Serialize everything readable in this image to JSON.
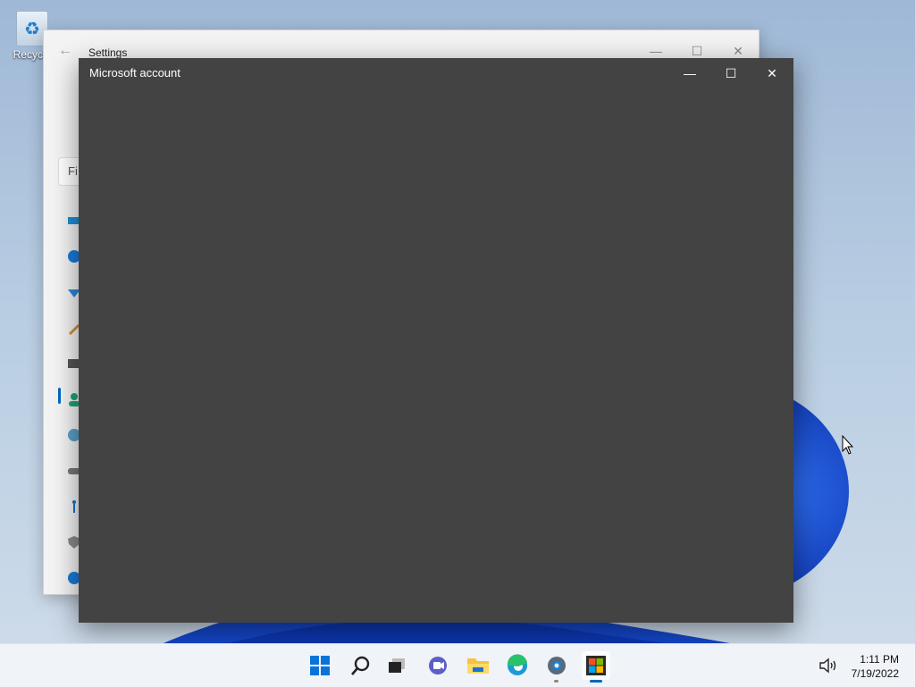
{
  "desktop": {
    "icons": [
      {
        "label": "Recycle",
        "icon": "recycle-bin-icon"
      }
    ]
  },
  "settings_window": {
    "title": "Settings",
    "search_placeholder": "Fi",
    "controls": {
      "minimize": "minimize-icon",
      "maximize": "maximize-icon",
      "close": "close-icon"
    },
    "nav_icons": [
      "system-icon",
      "bluetooth-icon",
      "network-icon",
      "personalization-icon",
      "apps-icon",
      "accounts-icon",
      "time-language-icon",
      "gaming-icon",
      "accessibility-icon",
      "privacy-security-icon",
      "windows-update-icon"
    ],
    "selected_nav": "accounts-icon"
  },
  "msa_dialog": {
    "title": "Microsoft account",
    "background": "#434343",
    "controls": {
      "minimize": "minimize-icon",
      "maximize": "maximize-icon",
      "close": "close-icon"
    }
  },
  "taskbar": {
    "apps": [
      "start-icon",
      "search-icon",
      "task-view-icon",
      "chat-icon",
      "file-explorer-icon",
      "edge-icon",
      "settings-icon",
      "microsoft-store-icon"
    ],
    "active_app": "microsoft-store-icon",
    "tray": {
      "volume_icon": "volume-icon"
    },
    "clock": {
      "time": "1:11 PM",
      "date": "7/19/2022"
    }
  }
}
